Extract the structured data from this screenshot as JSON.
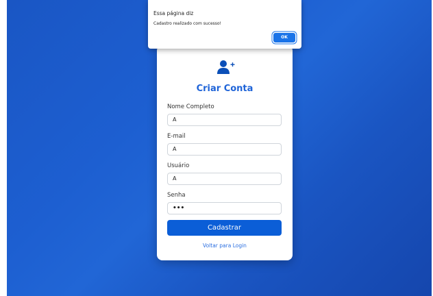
{
  "dialog": {
    "title": "Essa página diz",
    "message": "Cadastro realizado com sucesso!",
    "ok_label": "OK"
  },
  "form": {
    "title": "Criar Conta",
    "fields": [
      {
        "label": "Nome Completo",
        "value": "A"
      },
      {
        "label": "E-mail",
        "value": "A"
      },
      {
        "label": "Usuário",
        "value": "A"
      },
      {
        "label": "Senha",
        "value": "•••"
      }
    ],
    "submit_label": "Cadastrar",
    "back_link": "Voltar para Login"
  },
  "colors": {
    "accent": "#0b5ed7",
    "title": "#1f64d8",
    "background": "#1d5fd1"
  }
}
